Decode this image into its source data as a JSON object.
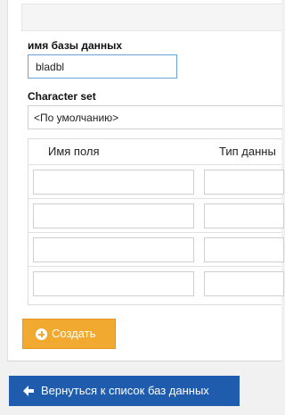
{
  "form": {
    "db_name_label": "имя базы данных",
    "db_name_value": "bladbl",
    "charset_label": "Character set",
    "charset_value": "<По умолчанию>"
  },
  "table": {
    "headers": [
      "Имя поля",
      "Тип данны"
    ],
    "rows": [
      {
        "name": "",
        "type": ""
      },
      {
        "name": "",
        "type": ""
      },
      {
        "name": "",
        "type": ""
      },
      {
        "name": "",
        "type": ""
      }
    ]
  },
  "buttons": {
    "create_label": "Создать",
    "back_label": "Вернуться к список баз данных"
  },
  "colors": {
    "create_bg": "#f2a930",
    "back_bg": "#1f5cad",
    "input_focus_border": "#6aa3d8"
  },
  "icons": {
    "create": "plus-circle-icon",
    "back": "arrow-left-icon"
  }
}
